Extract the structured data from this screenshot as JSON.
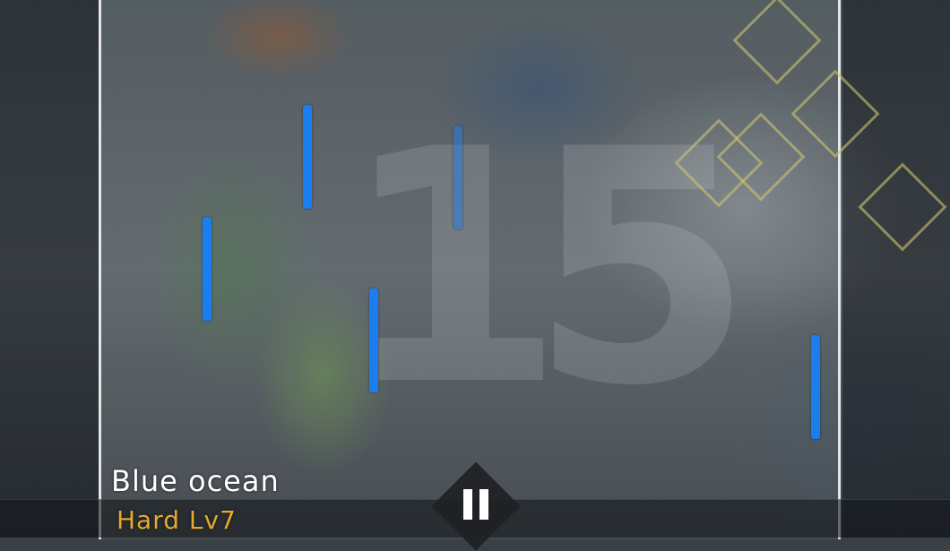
{
  "song": {
    "title": "Blue ocean",
    "difficulty": "Hard Lv7"
  },
  "combo": {
    "count": "15"
  },
  "colors": {
    "note": "#1a7ef0",
    "difficulty": "#e6a830",
    "title": "#ffffff",
    "hit_effect": "#cdc36e"
  },
  "icons": {
    "pause": "pause-icon"
  }
}
